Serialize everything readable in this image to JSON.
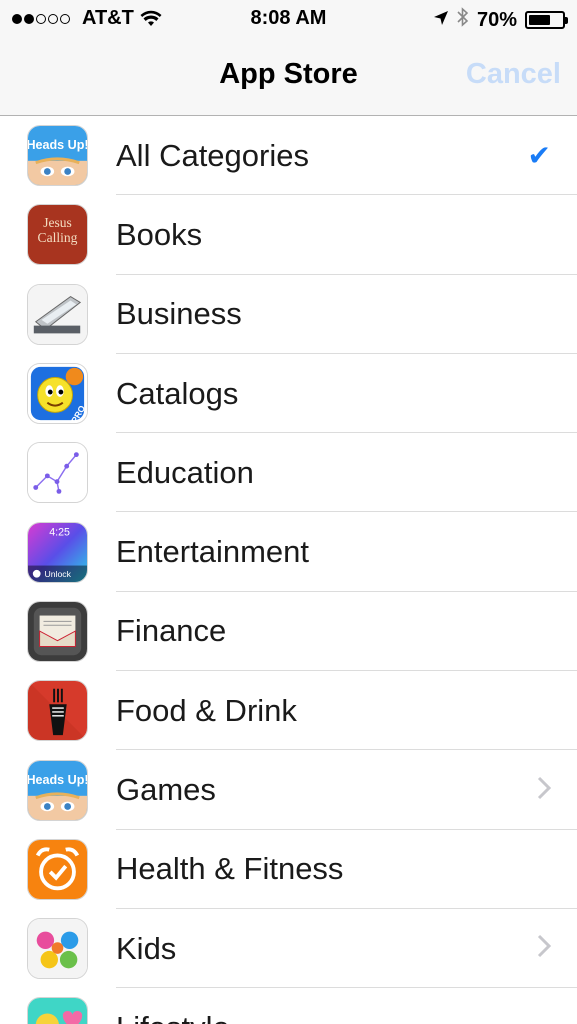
{
  "status_bar": {
    "carrier": "AT&T",
    "signal_bars_filled": 2,
    "signal_bars_total": 5,
    "time": "8:08 AM",
    "battery_percent": "70%",
    "battery_level": 0.7,
    "icons": [
      "wifi-icon",
      "location-arrow-icon",
      "bluetooth-icon",
      "battery-icon"
    ]
  },
  "nav": {
    "title": "App Store",
    "cancel_label": "Cancel"
  },
  "colors": {
    "accent": "#1a7cf6",
    "cancel_disabled": "#c7dcf8",
    "separator": "#dcdcdc"
  },
  "categories": [
    {
      "label": "All Categories",
      "icon": "heads-up-app-icon",
      "icon_text": "Heads Up!",
      "selected": true,
      "accessory": "checkmark"
    },
    {
      "label": "Books",
      "icon": "jesus-calling-app-icon",
      "icon_text": "Jesus Calling",
      "accessory": "none"
    },
    {
      "label": "Business",
      "icon": "scanner-app-icon",
      "accessory": "none"
    },
    {
      "label": "Catalogs",
      "icon": "emoji-pro-app-icon",
      "icon_text": "PRO",
      "accessory": "none"
    },
    {
      "label": "Education",
      "icon": "star-walk-app-icon",
      "accessory": "none"
    },
    {
      "label": "Entertainment",
      "icon": "lockscreen-app-icon",
      "icon_text": "4:25",
      "icon_subtext": "Unlock",
      "accessory": "none"
    },
    {
      "label": "Finance",
      "icon": "envelope-app-icon",
      "accessory": "none"
    },
    {
      "label": "Food & Drink",
      "icon": "fork-fist-app-icon",
      "accessory": "none"
    },
    {
      "label": "Games",
      "icon": "heads-up-app-icon",
      "icon_text": "Heads Up!",
      "accessory": "chevron"
    },
    {
      "label": "Health & Fitness",
      "icon": "alarm-clock-app-icon",
      "accessory": "none"
    },
    {
      "label": "Kids",
      "icon": "hand-prints-app-icon",
      "accessory": "chevron"
    },
    {
      "label": "Lifestyle",
      "icon": "emoji-hearts-app-icon",
      "accessory": "none"
    }
  ],
  "check_glyph": "✔"
}
